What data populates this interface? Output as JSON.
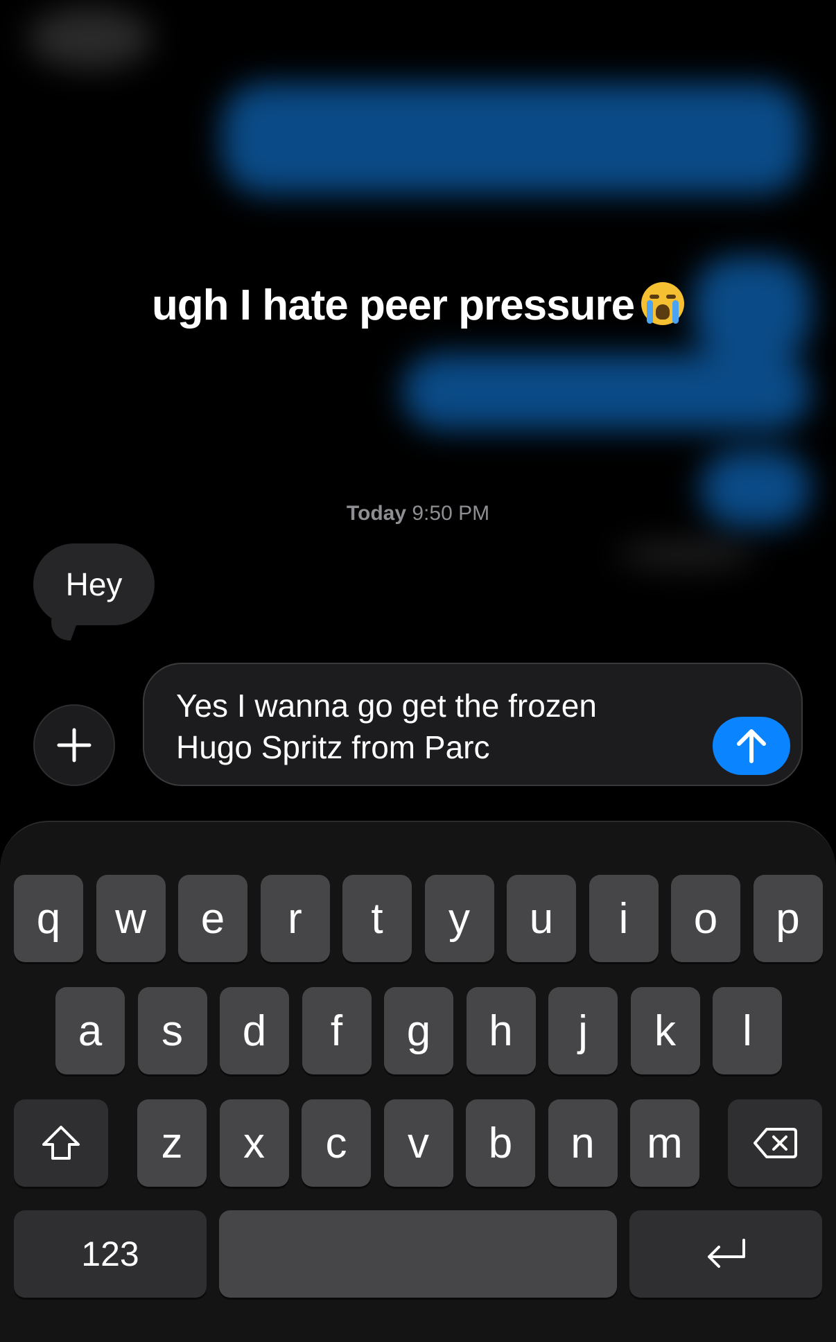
{
  "overlay": {
    "caption": "ugh I hate peer pressure",
    "caption_emoji": "loudly-crying-face"
  },
  "conversation": {
    "timestamp_day": "Today",
    "timestamp_time": "9:50 PM",
    "messages": [
      {
        "direction": "incoming",
        "text": "Hey"
      }
    ]
  },
  "compose": {
    "line1": "Yes I wanna go get the frozen",
    "line2": "Hugo Spritz from Parc",
    "plus_icon": "plus-icon",
    "send_icon": "arrow-up-icon",
    "send_color": "#0a84ff"
  },
  "keyboard": {
    "row1": [
      "q",
      "w",
      "e",
      "r",
      "t",
      "y",
      "u",
      "i",
      "o",
      "p"
    ],
    "row2": [
      "a",
      "s",
      "d",
      "f",
      "g",
      "h",
      "j",
      "k",
      "l"
    ],
    "row3": [
      "z",
      "x",
      "c",
      "v",
      "b",
      "n",
      "m"
    ],
    "numbers_label": "123",
    "shift_icon": "shift-icon",
    "delete_icon": "delete-icon",
    "return_icon": "return-icon"
  }
}
